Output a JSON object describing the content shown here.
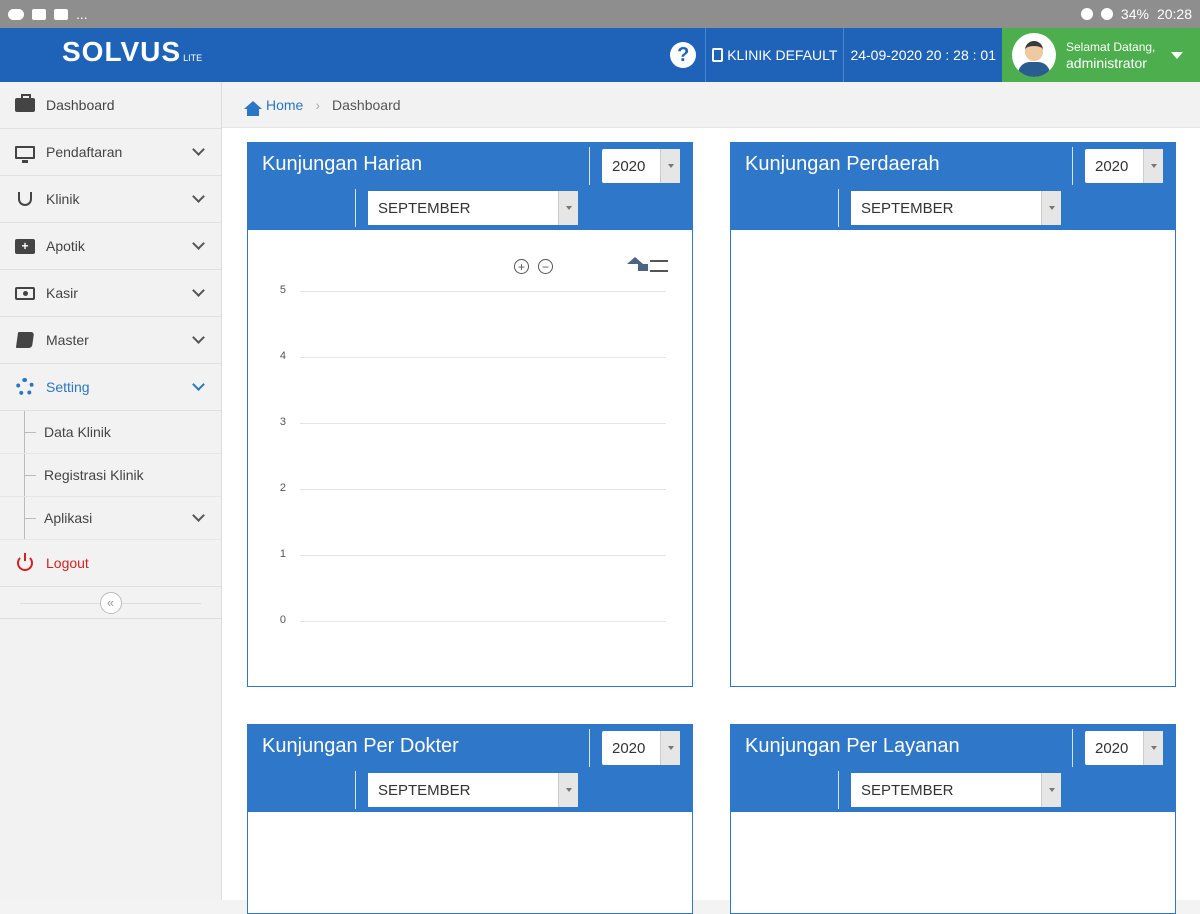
{
  "statusbar": {
    "ellipsis": "...",
    "battery": "34%",
    "time": "20:28"
  },
  "header": {
    "brand": "SOLVUS",
    "brand_suffix": "LITE",
    "help": "?",
    "clinic": "KLINIK DEFAULT",
    "datetime": "24-09-2020 20 : 28 : 01",
    "greeting": "Selamat Datang,",
    "username": "administrator"
  },
  "sidebar": {
    "items": [
      {
        "label": "Dashboard"
      },
      {
        "label": "Pendaftaran"
      },
      {
        "label": "Klinik"
      },
      {
        "label": "Apotik"
      },
      {
        "label": "Kasir"
      },
      {
        "label": "Master"
      },
      {
        "label": "Setting"
      }
    ],
    "subitems": [
      {
        "label": "Data Klinik"
      },
      {
        "label": "Registrasi Klinik"
      },
      {
        "label": "Aplikasi"
      }
    ],
    "logout": "Logout",
    "collapse": "«"
  },
  "breadcrumb": {
    "home": "Home",
    "separator": "›",
    "current": "Dashboard"
  },
  "panels": [
    {
      "title": "Kunjungan Harian",
      "year": "2020",
      "month": "SEPTEMBER"
    },
    {
      "title": "Kunjungan Perdaerah",
      "year": "2020",
      "month": "SEPTEMBER"
    },
    {
      "title": "Kunjungan Per Dokter",
      "year": "2020",
      "month": "SEPTEMBER"
    },
    {
      "title": "Kunjungan Per Layanan",
      "year": "2020",
      "month": "SEPTEMBER"
    }
  ],
  "chart_data": {
    "type": "line",
    "title": "",
    "xlabel": "",
    "ylabel": "",
    "yticks": [
      "5",
      "4",
      "3",
      "2",
      "1",
      "0"
    ],
    "ylim": [
      0,
      5
    ],
    "series": [],
    "grid": true,
    "toolbar": {
      "zoom_in": "+",
      "zoom_out": "−"
    }
  },
  "colors": {
    "header": "#1f63b8",
    "panel": "#2f77c8",
    "user": "#4cae4c",
    "logout": "#d62020",
    "active": "#2a76c6"
  }
}
